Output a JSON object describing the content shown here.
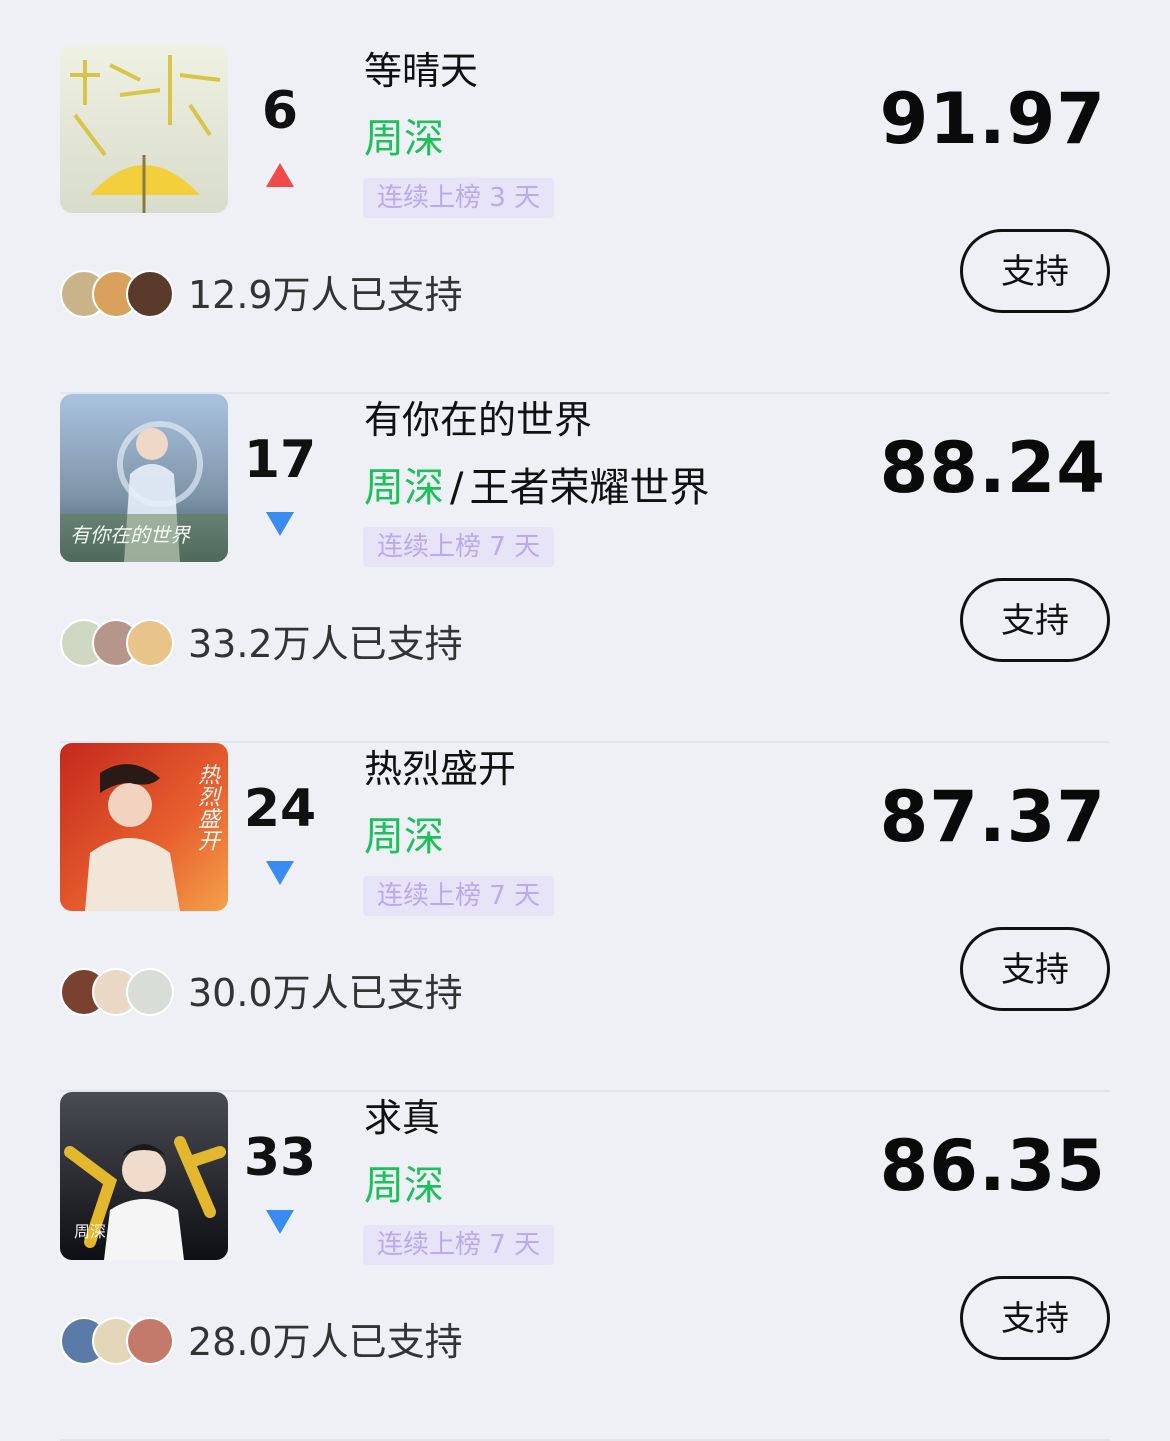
{
  "items": [
    {
      "rank": "6",
      "trend": "up",
      "title": "等晴天",
      "artist": "周深",
      "artist_extra": "",
      "streak": "连续上榜 3 天",
      "score": "91.97",
      "supporters": "12.9万人已支持",
      "support_label": "支持",
      "cover_text": "",
      "cover_colors": [
        "#eef0e0",
        "#d8dcc4"
      ]
    },
    {
      "rank": "17",
      "trend": "down",
      "title": "有你在的世界",
      "artist": "周深",
      "artist_extra": "王者荣耀世界",
      "streak": "连续上榜 7 天",
      "score": "88.24",
      "supporters": "33.2万人已支持",
      "support_label": "支持",
      "cover_text": "有你在的世界",
      "cover_colors": [
        "#9fb6d6",
        "#4d6a8e"
      ]
    },
    {
      "rank": "24",
      "trend": "down",
      "title": "热烈盛开",
      "artist": "周深",
      "artist_extra": "",
      "streak": "连续上榜 7 天",
      "score": "87.37",
      "supporters": "30.0万人已支持",
      "support_label": "支持",
      "cover_text": "热烈盛开",
      "cover_colors": [
        "#e85a2c",
        "#a8281a"
      ]
    },
    {
      "rank": "33",
      "trend": "down",
      "title": "求真",
      "artist": "周深",
      "artist_extra": "",
      "streak": "连续上榜 7 天",
      "score": "86.35",
      "supporters": "28.0万人已支持",
      "support_label": "支持",
      "cover_text": "周深",
      "cover_colors": [
        "#3a3c44",
        "#101116"
      ]
    }
  ],
  "colors": {
    "up_arrow": "#f04a4a",
    "down_arrow": "#3b8cf0",
    "artist_green": "#1cc15c",
    "streak_bg": "#e7e4f8",
    "streak_text": "#bca9ef"
  }
}
